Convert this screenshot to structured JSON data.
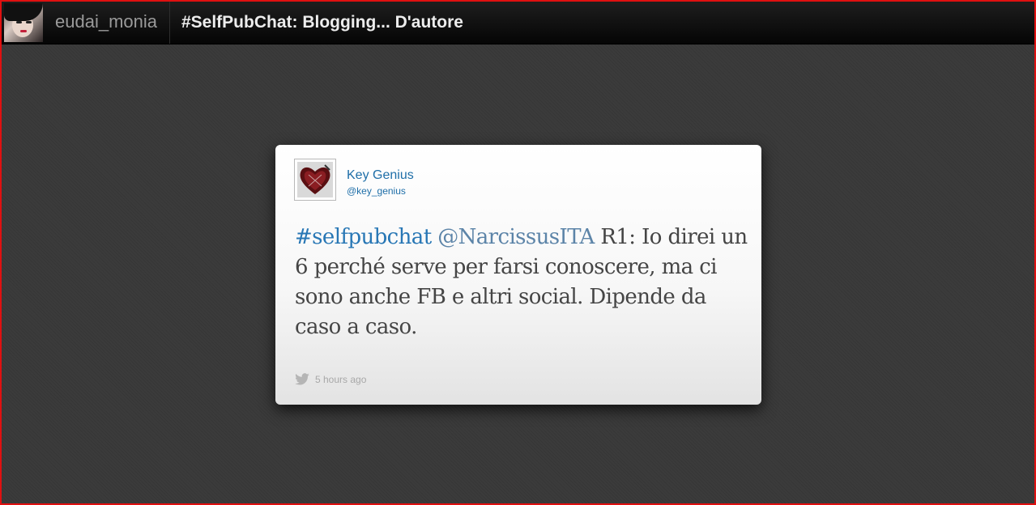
{
  "header": {
    "username": "eudai_monia",
    "title": "#SelfPubChat: Blogging... D'autore"
  },
  "tweet": {
    "author_name": "Key Genius",
    "author_handle": "@key_genius",
    "hashtag": "#selfpubchat",
    "mention": "@NarcissusITA",
    "text": " R1: Io direi un 6 perché serve per farsi conoscere, ma ci sono anche FB e altri social. Dipende da caso a caso.",
    "timestamp": "5 hours ago"
  },
  "colors": {
    "frame_border": "#e01010",
    "link": "#2877b5",
    "background": "#3b3b3b"
  },
  "icons": {
    "user_avatar": "avatar-photo",
    "author_avatar": "heart-avatar-icon",
    "footer_icon": "twitter-bird-icon"
  }
}
